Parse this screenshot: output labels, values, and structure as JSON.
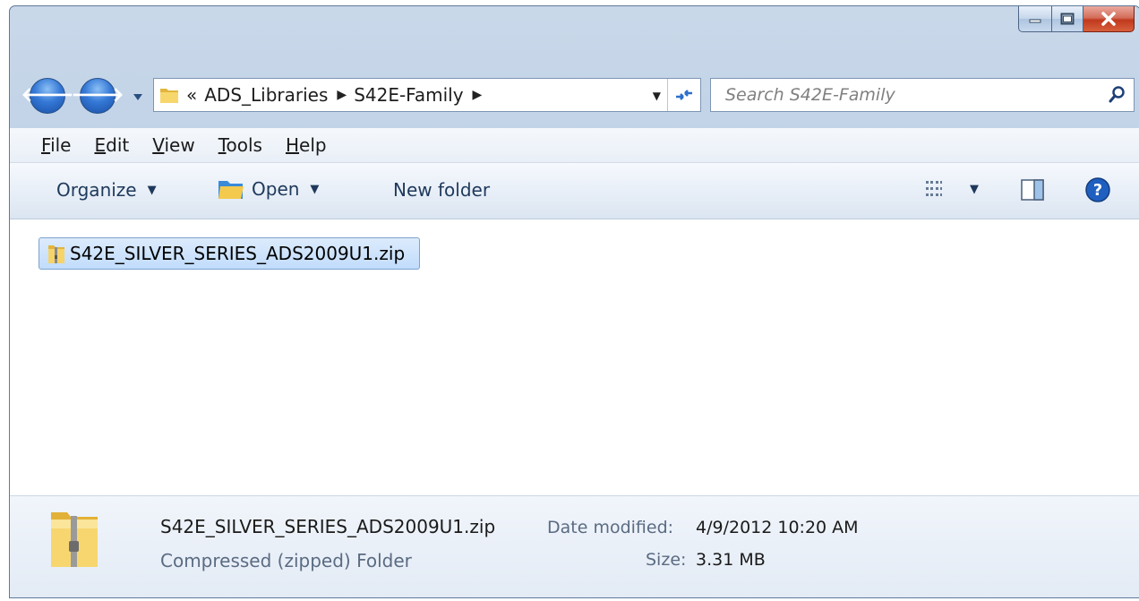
{
  "window": {
    "controls": {
      "minimize_icon": "minimize-icon",
      "maximize_icon": "maximize-icon",
      "close_icon": "close-icon"
    }
  },
  "navigation": {
    "breadcrumbs": [
      "ADS_Libraries",
      "S42E-Family"
    ],
    "overflow_glyph": "«",
    "search_placeholder": "Search S42E-Family"
  },
  "menu": {
    "items": [
      {
        "label": "File"
      },
      {
        "label": "Edit"
      },
      {
        "label": "View"
      },
      {
        "label": "Tools"
      },
      {
        "label": "Help"
      }
    ]
  },
  "toolbar": {
    "organize_label": "Organize",
    "open_label": "Open",
    "new_folder_label": "New folder"
  },
  "files": [
    {
      "name": "S42E_SILVER_SERIES_ADS2009U1.zip",
      "selected": true
    }
  ],
  "details": {
    "name": "S42E_SILVER_SERIES_ADS2009U1.zip",
    "type": "Compressed (zipped) Folder",
    "date_label": "Date modified:",
    "date_value": "4/9/2012 10:20 AM",
    "size_label": "Size:",
    "size_value": "3.31 MB"
  },
  "colors": {
    "selection": "#c1dcfc",
    "folder": "#f4cf5a",
    "nav_button": "#3478d6",
    "close_button": "#c0391d"
  }
}
